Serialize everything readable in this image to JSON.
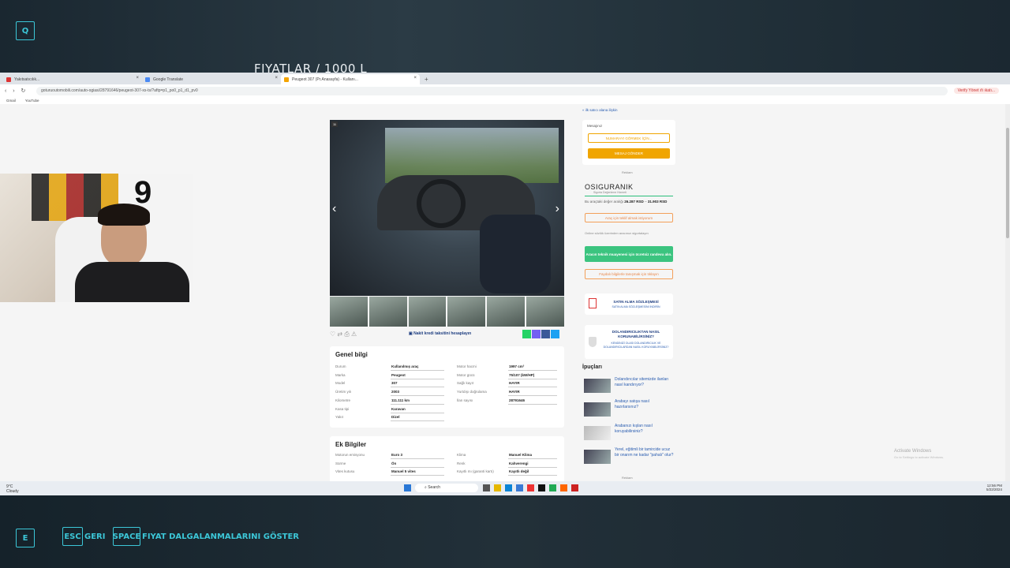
{
  "overlay": {
    "title": "FIYATLAR / 1000 L",
    "key_top": "Q",
    "key_bottom": "E",
    "esc_key": "ESC",
    "esc_label": "GERI",
    "space_key": "SPACE",
    "space_label": "FIYAT DALGALANMALARINI GÖSTER",
    "accent": "#3cc7d8"
  },
  "browser": {
    "tabs": [
      {
        "label": "Yakıtsatıcılık...",
        "active": false
      },
      {
        "label": "Google Translate",
        "active": false
      },
      {
        "label": "Peugeot 307 (Pr.Anasayfa) - Kullanı...",
        "active": true
      }
    ],
    "url": "goturuoutomobili.com/auto-ogiasi/28791646/peugeot-307-xs-ts/?aftp=p1_po0_p1_d1_pv0",
    "profile": "Verify Yönet ıfı ıkatı...",
    "bookmarks": [
      "Gmail",
      "YouTube"
    ]
  },
  "listing": {
    "photo_counter": "11",
    "credit_link": "Nakit kredi taksitini hesaplayın",
    "general_title": "Genel bilgi",
    "general_left": [
      {
        "k": "Durum",
        "v": "Kullanılmış araç"
      },
      {
        "k": "Marka",
        "v": "Peugeot"
      },
      {
        "k": "Model",
        "v": "307"
      },
      {
        "k": "Üretim yılı",
        "v": "2003"
      },
      {
        "k": "Kilometre",
        "v": "111.111 km"
      },
      {
        "k": "Kasa tipi",
        "v": "Karavan"
      },
      {
        "k": "Yakıt",
        "v": "Dizel"
      }
    ],
    "general_right": [
      {
        "k": "Motor hacmi",
        "v": "1997 cm³"
      },
      {
        "k": "Motor gücü",
        "v": "75/107 (kW/HP)"
      },
      {
        "k": "Sağlı kayıt",
        "v": "HAYIR"
      },
      {
        "k": "Yurtdışı doğrulama",
        "v": "HAYIR"
      },
      {
        "k": "İlan sayısı",
        "v": "28791646"
      }
    ],
    "extra_title": "Ek Bilgiler",
    "extra_left": [
      {
        "k": "Motorun emisyonu",
        "v": "Euro 3"
      },
      {
        "k": "Sürme",
        "v": "Ön"
      },
      {
        "k": "Vites kutusu",
        "v": "Manuel 5 vites"
      }
    ],
    "extra_right": [
      {
        "k": "Klima",
        "v": "Manuel Klima"
      },
      {
        "k": "Renk",
        "v": "Kahverengi"
      },
      {
        "k": "Kayıtlı mı (garanti kartı)",
        "v": "Kayıtlı değil"
      }
    ]
  },
  "sidebar": {
    "back_link": "« ilk satıcı alana ilişkin",
    "message_label": "Mesajınız",
    "show_number": "NUMARAYI GÖRMEK İÇİN...",
    "send_message": "MESAJ GÖNDER",
    "ad_label": "Reklam",
    "insurer": "OSIGURANIK",
    "insurer_sub": "Sigorta Değerleme Hizmeti",
    "price_text": "Bu araçtaki değer aralığı",
    "price_low": "26.287 RSD",
    "price_high": "31.903 RSD",
    "insurer_btn": "Araç için teklif almak istiyorum",
    "online_note": "Online sözlük üzerinden aracınızı sigortalayın",
    "green_btn": "Aracın teknik muayenesi için ücretsiz randevu alın.",
    "orange_outline_btn": "Faydalı bilgilerle tanışmak için tıklayın",
    "contract_title": "SATIN ALMA SÖZLEŞMESİ",
    "contract_sub": "SATIN ALMA SÖZLEŞMESİNİ İNDİRİN",
    "fraud_title": "DOLANDIRICILIKTAN NASIL KORUNABİLİRSİNİZ?",
    "fraud_sub": "KENDİNİZİ OLASI DOLANDIRICILIK VE DOLANDIRICILARDAN NASIL KORUYABİLİRSİNİZ?",
    "tips_title": "İpuçları",
    "tips": [
      "Dolandırıcılar sitemizde ilanları nasıl kandırıyor?",
      "Arabayı satışa nasıl hazırlarsınız?",
      "Arabanızı kışlan nasıl koruyabilirsiniz?",
      "Yerel, eğitimli bir tamircide ucuz bir onarım ne kadar \"pahalı\" olur?"
    ]
  },
  "taskbar": {
    "weather_temp": "9°C",
    "weather_desc": "Cloudy",
    "search": "Search",
    "time": "12:56 PM",
    "date": "5/22/2024",
    "watermark_title": "Activate Windows",
    "watermark_sub": "Go to Settings to activate Windows."
  }
}
